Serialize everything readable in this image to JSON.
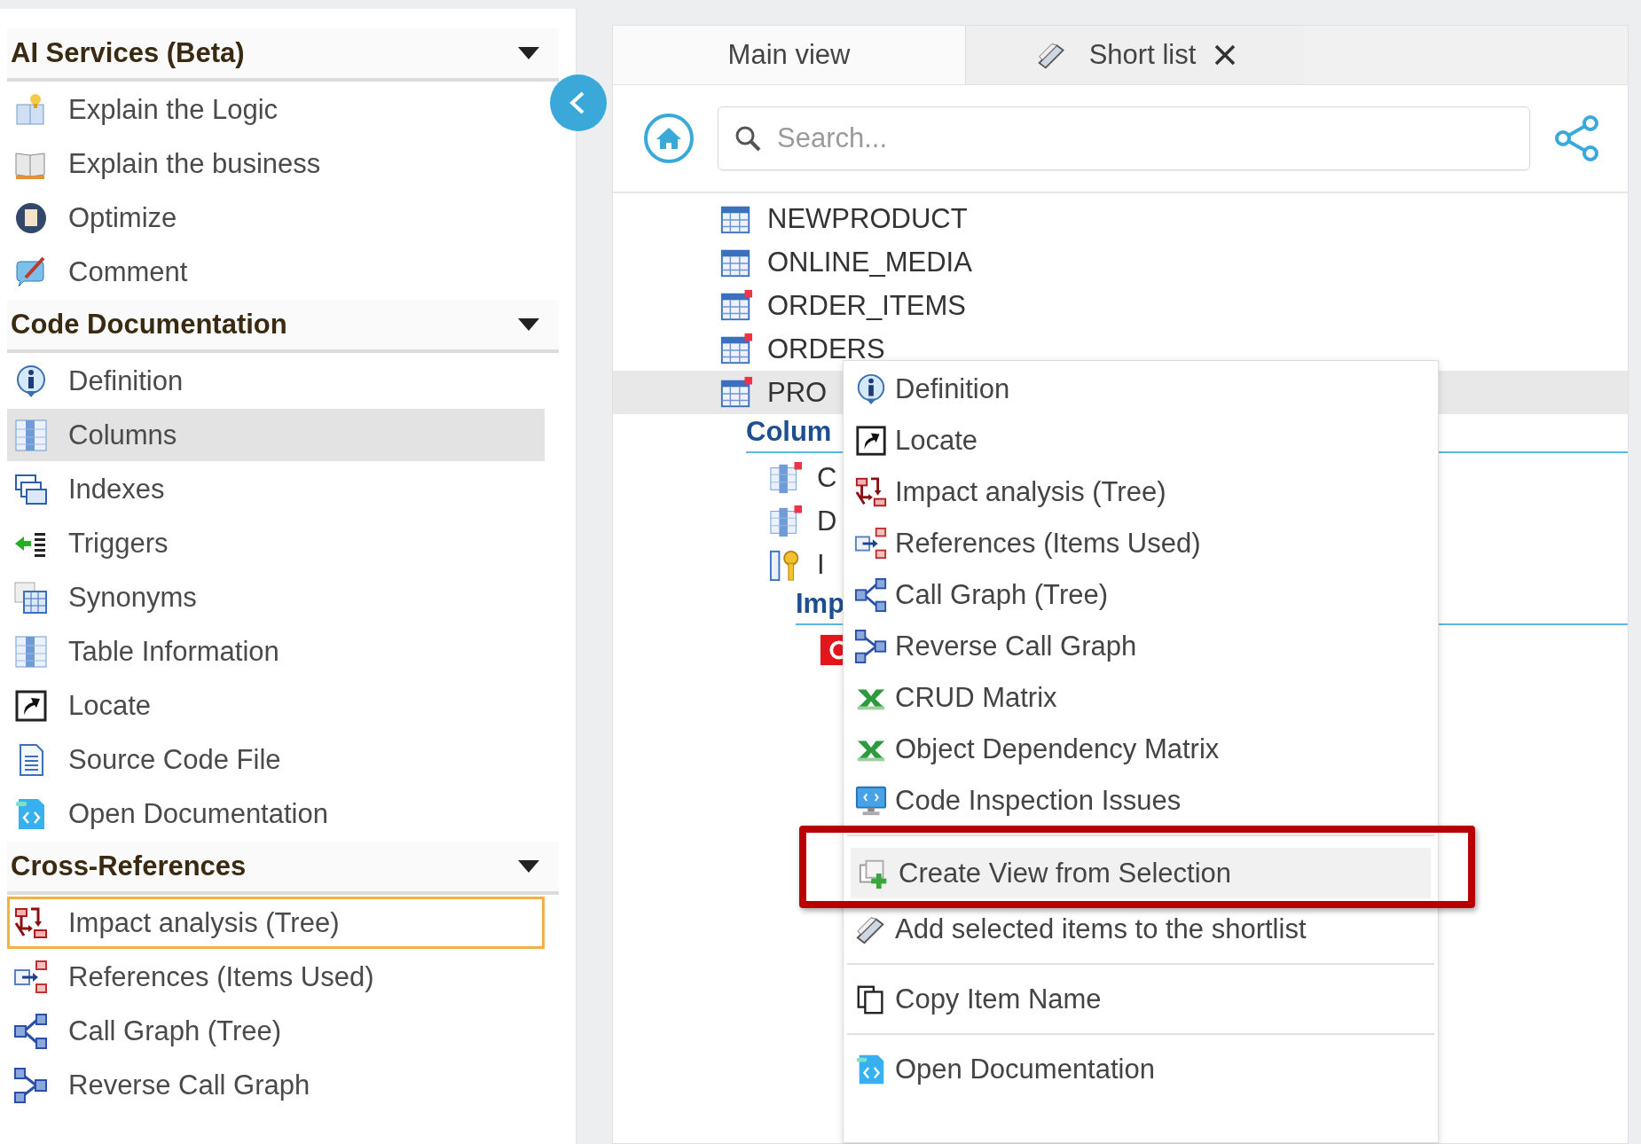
{
  "sidebar": {
    "sections": [
      {
        "title": "AI Services (Beta)",
        "expanded": true,
        "items": [
          {
            "label": "Explain the Logic",
            "selected": false,
            "focused": false
          },
          {
            "label": "Explain the business",
            "selected": false,
            "focused": false
          },
          {
            "label": "Optimize",
            "selected": false,
            "focused": false
          },
          {
            "label": "Comment",
            "selected": false,
            "focused": false
          }
        ]
      },
      {
        "title": "Code Documentation",
        "expanded": true,
        "items": [
          {
            "label": "Definition",
            "selected": false,
            "focused": false
          },
          {
            "label": "Columns",
            "selected": true,
            "focused": false
          },
          {
            "label": "Indexes",
            "selected": false,
            "focused": false
          },
          {
            "label": "Triggers",
            "selected": false,
            "focused": false
          },
          {
            "label": "Synonyms",
            "selected": false,
            "focused": false
          },
          {
            "label": "Table Information",
            "selected": false,
            "focused": false
          },
          {
            "label": "Locate",
            "selected": false,
            "focused": false
          },
          {
            "label": "Source Code File",
            "selected": false,
            "focused": false
          },
          {
            "label": "Open Documentation",
            "selected": false,
            "focused": false
          }
        ]
      },
      {
        "title": "Cross-References",
        "expanded": true,
        "items": [
          {
            "label": "Impact analysis (Tree)",
            "selected": false,
            "focused": true
          },
          {
            "label": "References (Items Used)",
            "selected": false,
            "focused": false
          },
          {
            "label": "Call Graph (Tree)",
            "selected": false,
            "focused": false
          },
          {
            "label": "Reverse Call Graph",
            "selected": false,
            "focused": false
          }
        ]
      }
    ]
  },
  "tabs": [
    {
      "label": "Main view",
      "selected": true,
      "closable": false
    },
    {
      "label": "Short list",
      "selected": false,
      "closable": true
    }
  ],
  "search": {
    "placeholder": "Search..."
  },
  "tree": {
    "rows": [
      {
        "label": "NEWPRODUCT",
        "kind": "table",
        "flagged": false,
        "selected": false
      },
      {
        "label": "ONLINE_MEDIA",
        "kind": "table",
        "flagged": false,
        "selected": false
      },
      {
        "label": "ORDER_ITEMS",
        "kind": "table",
        "flagged": true,
        "selected": false
      },
      {
        "label": "ORDERS",
        "kind": "table",
        "flagged": true,
        "selected": false
      },
      {
        "label": "PRO",
        "kind": "table",
        "flagged": true,
        "selected": true,
        "children": [
          {
            "label": "Colum",
            "kind": "group",
            "children": [
              {
                "label": "C",
                "kind": "column",
                "flagged": true
              },
              {
                "label": "D",
                "kind": "column",
                "flagged": true
              },
              {
                "label": "I",
                "kind": "key-column",
                "flagged": false,
                "children": [
                  {
                    "label": "Imp",
                    "kind": "group",
                    "children": [
                      {
                        "kind": "code-object"
                      }
                    ]
                  }
                ]
              }
            ]
          }
        ]
      }
    ]
  },
  "context_menu": {
    "groups": [
      {
        "items": [
          {
            "label": "Definition",
            "hovered": false,
            "highlighted": false
          },
          {
            "label": "Locate",
            "hovered": false,
            "highlighted": false
          },
          {
            "label": "Impact analysis (Tree)",
            "hovered": false,
            "highlighted": false
          },
          {
            "label": "References (Items Used)",
            "hovered": false,
            "highlighted": false
          },
          {
            "label": "Call Graph (Tree)",
            "hovered": false,
            "highlighted": false
          },
          {
            "label": "Reverse Call Graph",
            "hovered": false,
            "highlighted": false
          },
          {
            "label": "CRUD Matrix",
            "hovered": false,
            "highlighted": false
          },
          {
            "label": "Object Dependency Matrix",
            "hovered": false,
            "highlighted": false
          },
          {
            "label": "Code Inspection Issues",
            "hovered": false,
            "highlighted": false
          }
        ]
      },
      {
        "items": [
          {
            "label": "Create View from Selection",
            "hovered": true,
            "highlighted": true
          },
          {
            "label": "Add selected items to the shortlist",
            "hovered": false,
            "highlighted": false
          }
        ]
      },
      {
        "items": [
          {
            "label": "Copy Item Name",
            "hovered": false,
            "highlighted": false
          }
        ]
      },
      {
        "items": [
          {
            "label": "Open Documentation",
            "hovered": false,
            "highlighted": false
          }
        ]
      }
    ]
  }
}
